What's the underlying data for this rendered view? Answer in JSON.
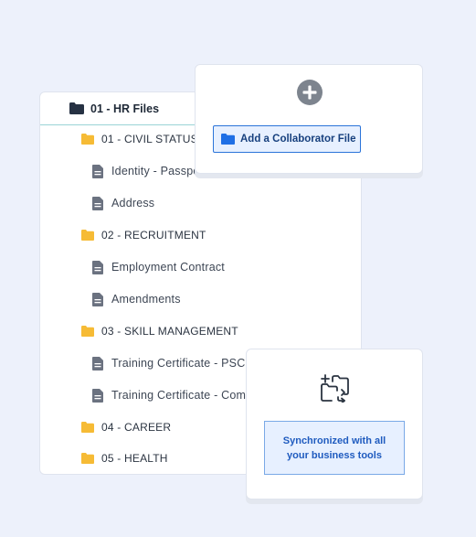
{
  "tree": {
    "root": {
      "label": "01 - HR Files",
      "icon": "folder-dark-icon"
    },
    "items": [
      {
        "type": "folder",
        "label": "01 - CIVIL STATUS",
        "icon": "folder-icon"
      },
      {
        "type": "file",
        "label": "Identity - Passpo",
        "icon": "document-icon"
      },
      {
        "type": "file",
        "label": "Address",
        "icon": "document-icon"
      },
      {
        "type": "folder",
        "label": "02 - RECRUITMENT",
        "icon": "folder-icon"
      },
      {
        "type": "file",
        "label": "Employment Contract",
        "icon": "document-icon"
      },
      {
        "type": "file",
        "label": "Amendments",
        "icon": "document-icon"
      },
      {
        "type": "folder",
        "label": "03 - SKILL MANAGEMENT",
        "icon": "folder-icon"
      },
      {
        "type": "file",
        "label": "Training Certificate - PSC",
        "icon": "document-icon"
      },
      {
        "type": "file",
        "label": "Training Certificate - Com",
        "icon": "document-icon"
      },
      {
        "type": "folder",
        "label": "04 - CAREER",
        "icon": "folder-icon"
      },
      {
        "type": "folder",
        "label": "05 - HEALTH",
        "icon": "folder-icon"
      }
    ]
  },
  "add_card": {
    "plus_icon": "plus-circle-icon",
    "button_label": "Add a Collaborator File",
    "button_icon": "folder-blue-icon"
  },
  "sync_card": {
    "icon": "folder-sync-icon",
    "text": "Synchronized with all your business tools"
  },
  "colors": {
    "background": "#edf1fb",
    "folder": "#f6bb35",
    "accent": "#2b74d9",
    "sync_text": "#1f5bbf"
  }
}
